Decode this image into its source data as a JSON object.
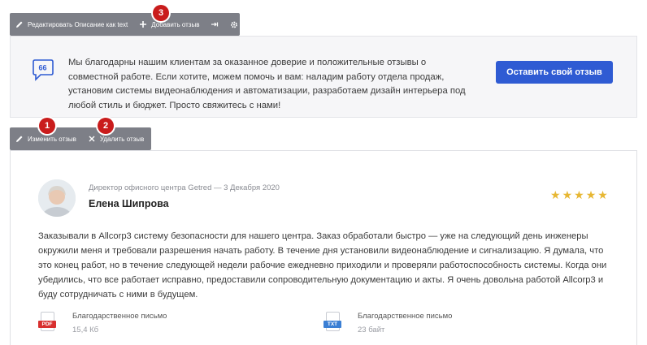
{
  "top_toolbar": {
    "edit_label": "Редактировать Описание как text",
    "add_review_label": "Добавить отзыв"
  },
  "review_toolbar": {
    "edit_label": "Изменить отзыв",
    "delete_label": "Удалить отзыв"
  },
  "badges": [
    "1",
    "2",
    "3"
  ],
  "intro": {
    "text": "Мы благодарны нашим клиентам за оказанное доверие и положительные отзывы о совместной работе. Если хотите, можем помочь и вам: наладим работу отдела продаж, установим системы видеонаблюдения и автоматизации, разработаем дизайн интерьера под любой стиль и бюджет. Просто свяжитесь с нами!",
    "cta_label": "Оставить свой отзыв"
  },
  "review": {
    "role_date": "Директор офисного центра Getred — 3 Декабря 2020",
    "author": "Елена Шипрова",
    "rating": 5,
    "text": "Заказывали в Allcorp3 систему безопасности для нашего центра. Заказ обработали быстро — уже на следующий день инженеры окружили меня и требовали разрешения начать работу. В течение дня установили видеонаблюдение и сигнализацию. Я думала, что это конец работ, но в течение следующей недели рабочие ежедневно приходили и проверяли работоспособность системы. Когда они убедились, что все работает исправно, предоставили сопроводительную документацию и акты. Я очень довольна работой Allcorp3 и буду сотрудничать с ними в будущем.",
    "files": [
      {
        "type": "PDF",
        "name": "Благодарственное письмо",
        "size": "15,4 Кб",
        "color": "#d8302f"
      },
      {
        "type": "TXT",
        "name": "Благодарственное письмо",
        "size": "23 байт",
        "color": "#3b7fd4"
      }
    ]
  },
  "colors": {
    "accent": "#2f5bd3",
    "star": "#e7b733",
    "badge": "#c91c1c",
    "toolbar": "#7d7f87"
  }
}
